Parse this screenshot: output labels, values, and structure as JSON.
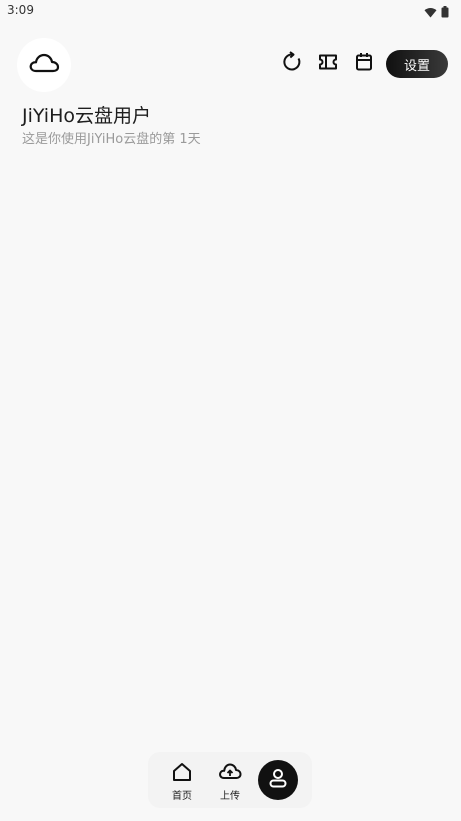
{
  "status_bar": {
    "time": "3:09",
    "icons": [
      "wifi-icon",
      "battery-icon"
    ]
  },
  "header": {
    "avatar_icon": "cloud-icon",
    "actions": [
      {
        "name": "refresh-icon"
      },
      {
        "name": "ticket-icon"
      },
      {
        "name": "calendar-icon"
      }
    ],
    "settings_label": "设置"
  },
  "profile": {
    "name": "JiYiHo云盘用户",
    "subtitle": "这是你使用JiYiHo云盘的第 1天"
  },
  "bottom_nav": {
    "items": [
      {
        "label": "首页",
        "icon": "home-icon"
      },
      {
        "label": "上传",
        "icon": "cloud-upload-icon"
      },
      {
        "label": "",
        "icon": "user-icon",
        "active": true
      }
    ]
  },
  "colors": {
    "background": "#f8f8f8",
    "accent": "#111111",
    "subtitle": "#9a9a9a"
  }
}
